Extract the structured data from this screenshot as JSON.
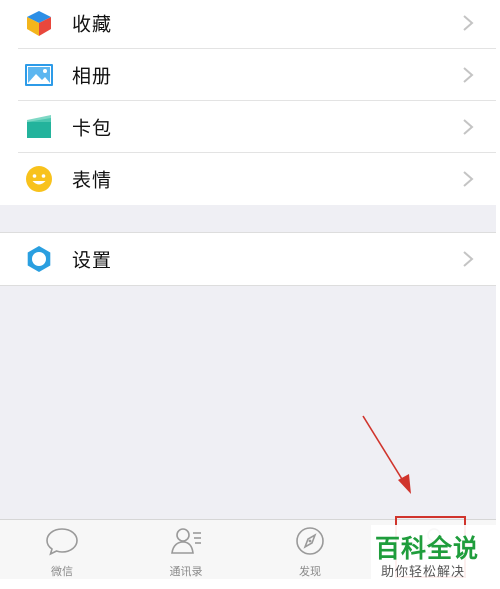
{
  "menu_group_1": [
    {
      "label": "收藏",
      "icon": "favorites-cube-icon"
    },
    {
      "label": "相册",
      "icon": "album-photo-icon"
    },
    {
      "label": "卡包",
      "icon": "card-wallet-icon"
    },
    {
      "label": "表情",
      "icon": "sticker-smiley-icon"
    }
  ],
  "menu_group_2": [
    {
      "label": "设置",
      "icon": "settings-gear-icon"
    }
  ],
  "tabbar": {
    "tabs": [
      {
        "label": "微信",
        "icon": "chat-bubble-icon"
      },
      {
        "label": "通讯录",
        "icon": "contacts-icon"
      },
      {
        "label": "发现",
        "icon": "compass-icon"
      },
      {
        "label": "",
        "icon": "me-icon"
      }
    ]
  },
  "annotation": {
    "highlight_color": "#d0342c"
  },
  "watermark": {
    "title": "百科全说",
    "subtitle": "助你轻松解决"
  },
  "colors": {
    "background": "#efeff4",
    "tab_text": "#8a8a8a",
    "watermark_green": "#1f9d3c",
    "settings_blue": "#2a9fe0",
    "card_green": "#23b39c",
    "album_blue": "#2d9be8",
    "smiley_yellow": "#f8c21c"
  }
}
